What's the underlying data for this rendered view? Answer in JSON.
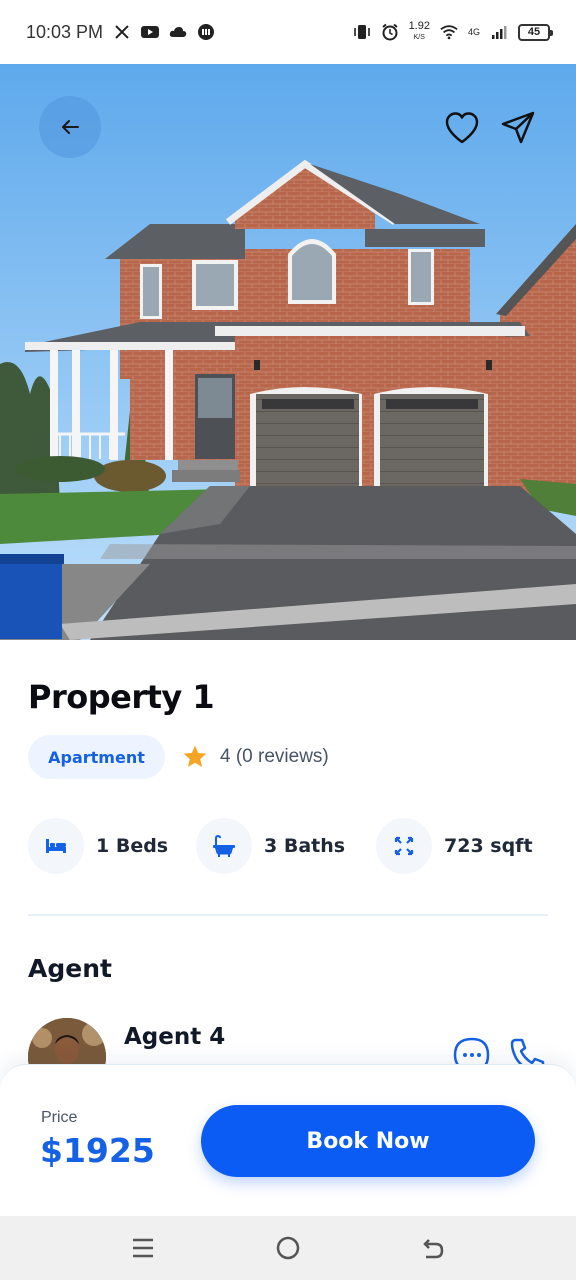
{
  "status_bar": {
    "time": "10:03 PM",
    "net_speed_value": "1.92",
    "net_speed_unit": "K/S",
    "network": "4G",
    "battery": "45"
  },
  "hero": {
    "icons": [
      "back-arrow-icon",
      "heart-icon",
      "send-icon"
    ]
  },
  "property": {
    "title": "Property 1",
    "type": "Apartment",
    "rating_text": "4 (0 reviews)",
    "features": [
      {
        "icon": "bed-icon",
        "label": "1 Beds"
      },
      {
        "icon": "bathtub-icon",
        "label": "3 Baths"
      },
      {
        "icon": "expand-icon",
        "label": "723 sqft"
      }
    ]
  },
  "agent": {
    "section_title": "Agent",
    "name": "Agent 4"
  },
  "booking": {
    "price_label": "Price",
    "price_value": "$1925",
    "book_label": "Book Now"
  },
  "colors": {
    "accent": "#0a5cf5",
    "price": "#1561e6",
    "badge_bg": "#eef4ff",
    "star": "#f5a524"
  }
}
